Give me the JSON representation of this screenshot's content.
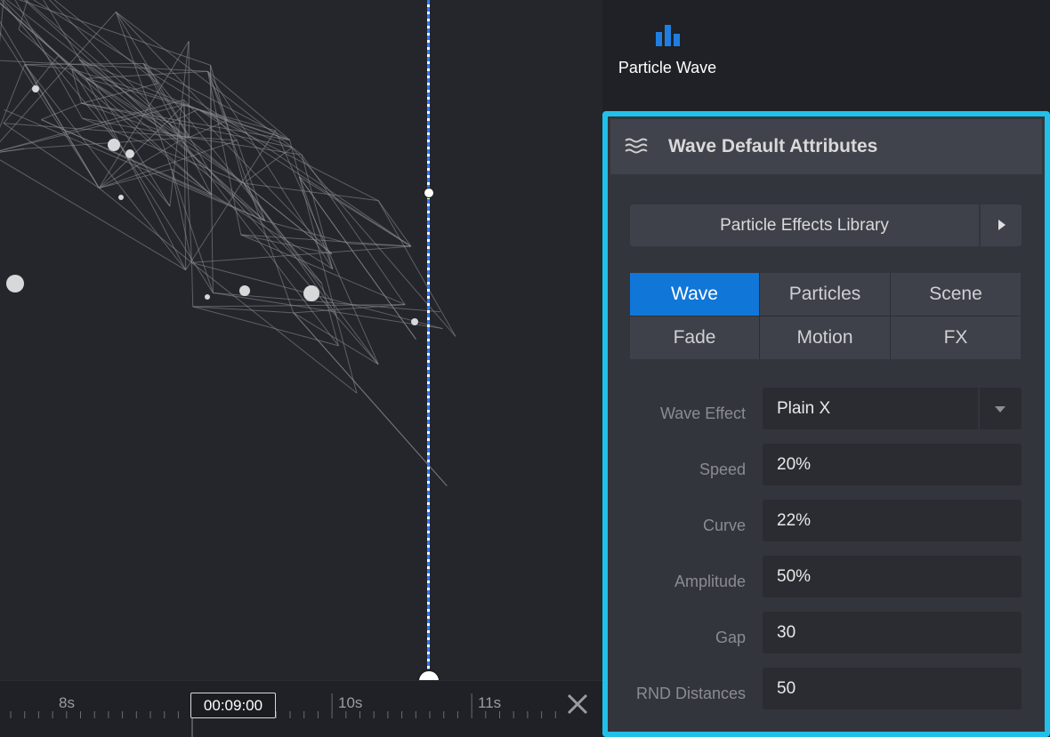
{
  "right_panel": {
    "particle_wave_label": "Particle Wave",
    "icon": "bar-chart-icon"
  },
  "attributes": {
    "title": "Wave Default Attributes",
    "header_icon": "waves-icon",
    "library_button": "Particle Effects Library",
    "tabs": [
      {
        "label": "Wave",
        "active": true
      },
      {
        "label": "Particles",
        "active": false
      },
      {
        "label": "Scene",
        "active": false
      },
      {
        "label": "Fade",
        "active": false
      },
      {
        "label": "Motion",
        "active": false
      },
      {
        "label": "FX",
        "active": false
      }
    ],
    "fields": {
      "wave_effect": {
        "label": "Wave Effect",
        "value": "Plain X"
      },
      "speed": {
        "label": "Speed",
        "value": "20%"
      },
      "curve": {
        "label": "Curve",
        "value": "22%"
      },
      "amplitude": {
        "label": "Amplitude",
        "value": "50%"
      },
      "gap": {
        "label": "Gap",
        "value": "30"
      },
      "rnd_distances": {
        "label": "RND Distances",
        "value": "50"
      }
    }
  },
  "timeline": {
    "current_time": "00:09:00",
    "tick_labels": [
      "8s",
      "10s",
      "11s"
    ]
  },
  "colors": {
    "accent": "#21c0e8",
    "active_tab": "#1076d8",
    "guide_line": "#2f7bff"
  }
}
